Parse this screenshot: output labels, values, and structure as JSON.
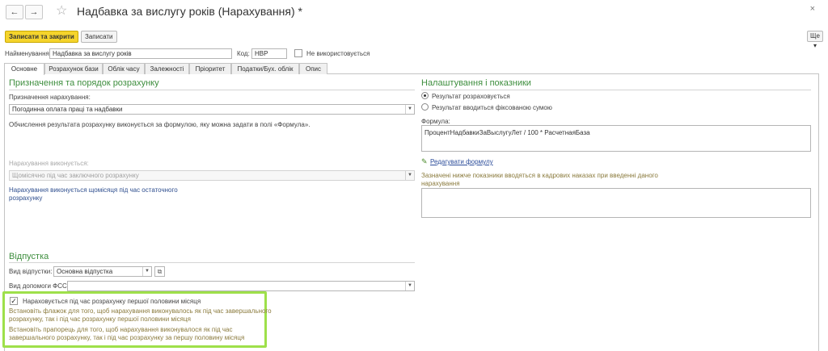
{
  "window": {
    "title": "Надбавка за вислугу років (Нарахування) *",
    "back_icon": "←",
    "forward_icon": "→",
    "favorite_icon": "☆",
    "close_icon": "×"
  },
  "toolbar": {
    "save_close_label": "Записати та закрити",
    "save_label": "Записати",
    "more_label": "Ще ▾"
  },
  "header": {
    "name_label": "Найменування:",
    "name_value": "Надбавка за вислугу років",
    "code_label": "Код:",
    "code_value": "НВР",
    "unused_label": "Не використовується"
  },
  "tabs": [
    {
      "label": "Основне"
    },
    {
      "label": "Розрахунок бази"
    },
    {
      "label": "Облік часу"
    },
    {
      "label": "Залежності"
    },
    {
      "label": "Пріоритет"
    },
    {
      "label": "Податки/Бух. облік"
    },
    {
      "label": "Опис"
    }
  ],
  "purpose": {
    "section_title": "Призначення та порядок розрахунку",
    "purpose_label": "Призначення нарахування:",
    "purpose_value": "Погодинна оплата праці та надбавки",
    "formula_note": "Обчислення результата розрахунку виконується за формулою, яку можна задати в полі «Формула».",
    "performed_label": "Нарахування виконується:",
    "performed_value": "Щомісячно під час заключного розрахунку",
    "performed_note_line1": "Нарахування виконується щомісяця під час остаточного",
    "performed_note_line2": "розрахунку"
  },
  "settings": {
    "section_title": "Налаштування і показники",
    "radio_calculated": "Результат розраховується",
    "radio_fixed": "Результат вводиться фіксованою сумою",
    "formula_label": "Формула:",
    "formula_value": "ПроцентНадбавкиЗаВыслугуЛет / 100 * РасчетнаяБаза",
    "edit_formula_link": "Редагувати формулу",
    "indicators_note_line1": "Зазначені нижче показники вводяться в кадрових наказах при введенні даного",
    "indicators_note_line2": "нарахування"
  },
  "leave": {
    "section_title": "Відпустка",
    "leave_type_label": "Вид відпустки:",
    "leave_type_value": "Основна відпустка",
    "fss_label": "Вид допомоги ФСС:",
    "fss_value": "",
    "first_half_label": "Нараховується під час розрахунку першої половини місяця",
    "hint1_line1": "Встановіть флажок для того, щоб нарахування виконувалось як під час завершального",
    "hint1_line2": "розрахунку, так і під час розрахунку першої половини місяця",
    "hint2_line1": "Встановіть прапорець для того, щоб нарахування виконувалося як під час",
    "hint2_line2": "завершального розрахунку, так і під час розрахунку за першу половину місяця"
  }
}
